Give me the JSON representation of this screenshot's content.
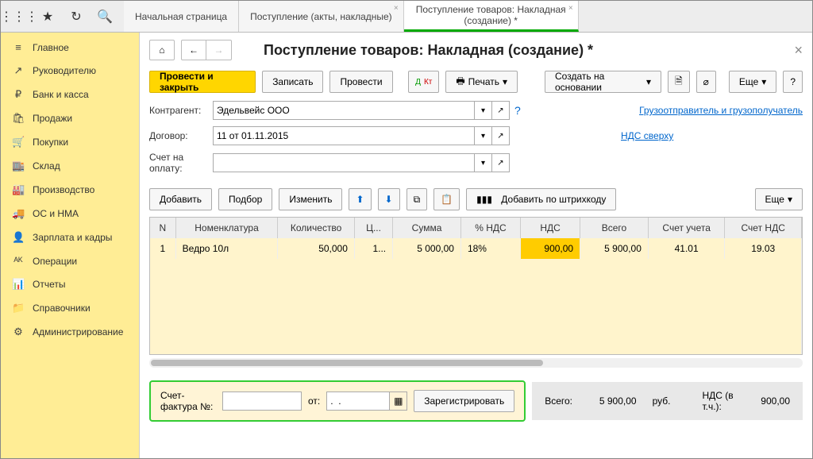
{
  "topTabs": [
    {
      "label": "Начальная страница",
      "closable": false
    },
    {
      "label": "Поступление (акты, накладные)",
      "closable": true
    },
    {
      "label": "Поступление товаров: Накладная (создание) *",
      "closable": true,
      "active": true
    }
  ],
  "sidebar": {
    "items": [
      {
        "icon": "≡",
        "label": "Главное"
      },
      {
        "icon": "↗",
        "label": "Руководителю"
      },
      {
        "icon": "₽",
        "label": "Банк и касса"
      },
      {
        "icon": "🛍",
        "label": "Продажи"
      },
      {
        "icon": "🛒",
        "label": "Покупки"
      },
      {
        "icon": "🏬",
        "label": "Склад"
      },
      {
        "icon": "🏭",
        "label": "Производство"
      },
      {
        "icon": "🚚",
        "label": "ОС и НМА"
      },
      {
        "icon": "👤",
        "label": "Зарплата и кадры"
      },
      {
        "icon": "ᴬᴷ",
        "label": "Операции"
      },
      {
        "icon": "📊",
        "label": "Отчеты"
      },
      {
        "icon": "📁",
        "label": "Справочники"
      },
      {
        "icon": "⚙",
        "label": "Администрирование"
      }
    ]
  },
  "page": {
    "title": "Поступление товаров: Накладная (создание) *",
    "toolbar": {
      "post_close": "Провести и закрыть",
      "save": "Записать",
      "post": "Провести",
      "print": "Печать",
      "create_on_basis": "Создать на основании",
      "more": "Еще"
    },
    "form": {
      "counterparty": {
        "label": "Контрагент:",
        "value": "Эдельвейс ООО"
      },
      "contract": {
        "label": "Договор:",
        "value": "11 от 01.11.2015"
      },
      "account": {
        "label": "Счет на оплату:",
        "value": ""
      },
      "link_shipper": "Грузоотправитель и грузополучатель",
      "link_vat": "НДС сверху"
    },
    "table_toolbar": {
      "add": "Добавить",
      "select": "Подбор",
      "edit": "Изменить",
      "by_barcode": "Добавить по штрихкоду",
      "more": "Еще"
    },
    "table": {
      "headers": [
        "N",
        "Номенклатура",
        "Количество",
        "Ц...",
        "Сумма",
        "% НДС",
        "НДС",
        "Всего",
        "Счет учета",
        "Счет НДС"
      ],
      "rows": [
        {
          "n": "1",
          "nom": "Ведро 10л",
          "qty": "50,000",
          "price": "1...",
          "sum": "5 000,00",
          "vat_p": "18%",
          "vat": "900,00",
          "total": "5 900,00",
          "acct": "41.01",
          "vat_acct": "19.03"
        }
      ]
    },
    "invoice": {
      "label": "Счет-фактура №:",
      "from": "от:",
      "date": ".  .",
      "register": "Зарегистрировать"
    },
    "totals": {
      "total_label": "Всего:",
      "total": "5 900,00",
      "cur": "руб.",
      "vat_label": "НДС (в т.ч.):",
      "vat": "900,00"
    }
  }
}
